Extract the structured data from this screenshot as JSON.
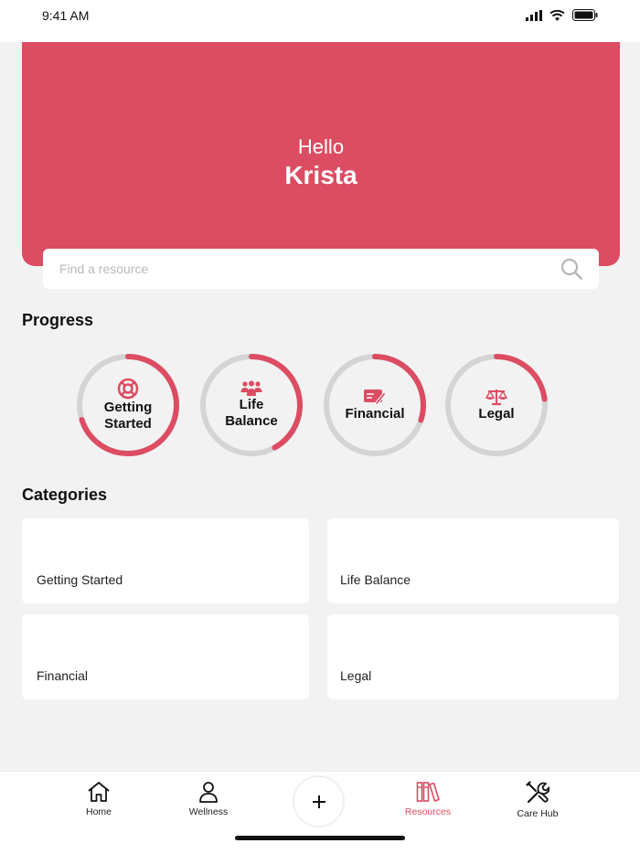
{
  "status_bar": {
    "time": "9:41 AM"
  },
  "hero": {
    "greeting": "Hello",
    "name": "Krista",
    "color": "#dc4c62"
  },
  "search": {
    "placeholder": "Find a resource"
  },
  "progress": {
    "title": "Progress",
    "items": [
      {
        "label": "Getting Started",
        "icon": "lifebuoy-icon",
        "value": 0.7
      },
      {
        "label": "Life Balance",
        "icon": "people-icon",
        "value": 0.42
      },
      {
        "label": "Financial",
        "icon": "check-pen-icon",
        "value": 0.3
      },
      {
        "label": "Legal",
        "icon": "scales-icon",
        "value": 0.23
      }
    ]
  },
  "categories": {
    "title": "Categories",
    "items": [
      "Getting Started",
      "Life Balance",
      "Financial",
      "Legal"
    ]
  },
  "tabbar": {
    "tabs": [
      {
        "label": "Home",
        "icon": "home-icon",
        "active": false
      },
      {
        "label": "Wellness",
        "icon": "person-icon",
        "active": false
      },
      {
        "label": "Resources",
        "icon": "books-icon",
        "active": true
      },
      {
        "label": "Care Hub",
        "icon": "tools-icon",
        "active": false
      }
    ],
    "add_icon": "plus-icon"
  }
}
